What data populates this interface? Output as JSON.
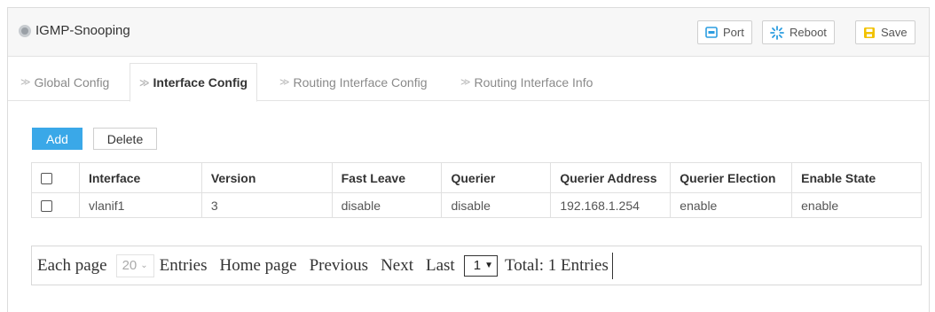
{
  "header": {
    "title": "IGMP-Snooping",
    "buttons": {
      "port": "Port",
      "reboot": "Reboot",
      "save": "Save"
    }
  },
  "tabs": [
    {
      "label": "Global Config",
      "active": false
    },
    {
      "label": "Interface Config",
      "active": true
    },
    {
      "label": "Routing Interface Config",
      "active": false
    },
    {
      "label": "Routing Interface Info",
      "active": false
    }
  ],
  "actions": {
    "add": "Add",
    "delete": "Delete"
  },
  "table": {
    "columns": [
      "Interface",
      "Version",
      "Fast Leave",
      "Querier",
      "Querier Address",
      "Querier Election",
      "Enable State"
    ],
    "rows": [
      [
        "vlanif1",
        "3",
        "disable",
        "disable",
        "192.168.1.254",
        "enable",
        "enable"
      ]
    ]
  },
  "pager": {
    "each_page": "Each page",
    "page_size": "20",
    "entries": "Entries",
    "home": "Home page",
    "previous": "Previous",
    "next": "Next",
    "last": "Last",
    "current_page": "1",
    "total": "Total: 1 Entries"
  },
  "colors": {
    "accent": "#3aa8e8",
    "reboot_icon": "#2b9de0",
    "save_icon": "#f2c200"
  }
}
